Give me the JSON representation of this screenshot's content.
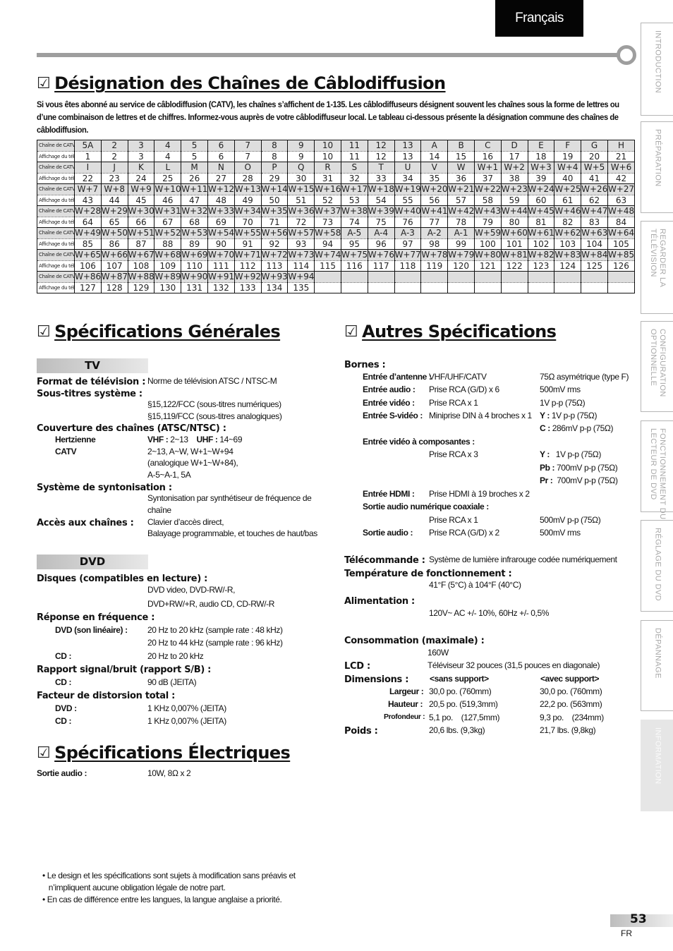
{
  "language_tab": "Français",
  "side_tabs": [
    {
      "label": "INTRODUCTION",
      "active": false
    },
    {
      "label": "PRÉPARATION",
      "active": false
    },
    {
      "label": "REGARDER LA\nTÉLÉVISION",
      "active": false
    },
    {
      "label": "CONFIGURATION\nOPTIONNELLE",
      "active": false
    },
    {
      "label": "FONCTIONNEMENT DU\nLECTEUR DE DVD",
      "active": false
    },
    {
      "label": "RÉGLAGE DU DVD",
      "active": false
    },
    {
      "label": "DÉPANNAGE",
      "active": false
    },
    {
      "label": "INFORMATION",
      "active": true
    }
  ],
  "checkbox_icon": "☑",
  "cable": {
    "title": "Désignation des Chaînes de Câblodiffusion",
    "intro": "Si vous êtes abonné au service de câblodiffusion (CATV), les chaînes s’affichent de 1-135. Les câblodiffuseurs désignent souvent les chaînes sous la forme de lettres ou d’une combinaison de lettres et de chiffres. Informez-vous auprès de votre câblodiffuseur local. Le tableau ci-dessous présente la désignation commune des chaînes de câblodiffusion.",
    "row_label_catv": "Chaîne de CATV",
    "row_label_display": "Affichage du téléviseur",
    "rows": [
      {
        "catv": [
          "5A",
          "2",
          "3",
          "4",
          "5",
          "6",
          "7",
          "8",
          "9",
          "10",
          "11",
          "12",
          "13",
          "A",
          "B",
          "C",
          "D",
          "E",
          "F",
          "G",
          "H"
        ],
        "display": [
          "1",
          "2",
          "3",
          "4",
          "5",
          "6",
          "7",
          "8",
          "9",
          "10",
          "11",
          "12",
          "13",
          "14",
          "15",
          "16",
          "17",
          "18",
          "19",
          "20",
          "21"
        ]
      },
      {
        "catv": [
          "I",
          "J",
          "K",
          "L",
          "M",
          "N",
          "O",
          "P",
          "Q",
          "R",
          "S",
          "T",
          "U",
          "V",
          "W",
          "W+1",
          "W+2",
          "W+3",
          "W+4",
          "W+5",
          "W+6"
        ],
        "display": [
          "22",
          "23",
          "24",
          "25",
          "26",
          "27",
          "28",
          "29",
          "30",
          "31",
          "32",
          "33",
          "34",
          "35",
          "36",
          "37",
          "38",
          "39",
          "40",
          "41",
          "42"
        ]
      },
      {
        "catv": [
          "W+7",
          "W+8",
          "W+9",
          "W+10",
          "W+11",
          "W+12",
          "W+13",
          "W+14",
          "W+15",
          "W+16",
          "W+17",
          "W+18",
          "W+19",
          "W+20",
          "W+21",
          "W+22",
          "W+23",
          "W+24",
          "W+25",
          "W+26",
          "W+27"
        ],
        "display": [
          "43",
          "44",
          "45",
          "46",
          "47",
          "48",
          "49",
          "50",
          "51",
          "52",
          "53",
          "54",
          "55",
          "56",
          "57",
          "58",
          "59",
          "60",
          "61",
          "62",
          "63"
        ]
      },
      {
        "catv": [
          "W+28",
          "W+29",
          "W+30",
          "W+31",
          "W+32",
          "W+33",
          "W+34",
          "W+35",
          "W+36",
          "W+37",
          "W+38",
          "W+39",
          "W+40",
          "W+41",
          "W+42",
          "W+43",
          "W+44",
          "W+45",
          "W+46",
          "W+47",
          "W+48"
        ],
        "display": [
          "64",
          "65",
          "66",
          "67",
          "68",
          "69",
          "70",
          "71",
          "72",
          "73",
          "74",
          "75",
          "76",
          "77",
          "78",
          "79",
          "80",
          "81",
          "82",
          "83",
          "84"
        ]
      },
      {
        "catv": [
          "W+49",
          "W+50",
          "W+51",
          "W+52",
          "W+53",
          "W+54",
          "W+55",
          "W+56",
          "W+57",
          "W+58",
          "A-5",
          "A-4",
          "A-3",
          "A-2",
          "A-1",
          "W+59",
          "W+60",
          "W+61",
          "W+62",
          "W+63",
          "W+64"
        ],
        "display": [
          "85",
          "86",
          "87",
          "88",
          "89",
          "90",
          "91",
          "92",
          "93",
          "94",
          "95",
          "96",
          "97",
          "98",
          "99",
          "100",
          "101",
          "102",
          "103",
          "104",
          "105"
        ]
      },
      {
        "catv": [
          "W+65",
          "W+66",
          "W+67",
          "W+68",
          "W+69",
          "W+70",
          "W+71",
          "W+72",
          "W+73",
          "W+74",
          "W+75",
          "W+76",
          "W+77",
          "W+78",
          "W+79",
          "W+80",
          "W+81",
          "W+82",
          "W+83",
          "W+84",
          "W+85"
        ],
        "display": [
          "106",
          "107",
          "108",
          "109",
          "110",
          "111",
          "112",
          "113",
          "114",
          "115",
          "116",
          "117",
          "118",
          "119",
          "120",
          "121",
          "122",
          "123",
          "124",
          "125",
          "126"
        ]
      },
      {
        "catv": [
          "W+86",
          "W+87",
          "W+88",
          "W+89",
          "W+90",
          "W+91",
          "W+92",
          "W+93",
          "W+94",
          "",
          "",
          "",
          "",
          "",
          "",
          "",
          "",
          "",
          "",
          "",
          ""
        ],
        "display": [
          "127",
          "128",
          "129",
          "130",
          "131",
          "132",
          "133",
          "134",
          "135",
          "",
          "",
          "",
          "",
          "",
          "",
          "",
          "",
          "",
          "",
          "",
          ""
        ]
      }
    ]
  },
  "general": {
    "title": "Spécifications Générales",
    "tv_bar": "TV",
    "format_label": "Format de télévision :",
    "format_value": "Norme de télévision ATSC / NTSC-M",
    "subtitles_label": "Sous-titres système :",
    "subtitles_1": "§15,122/FCC (sous-titres numériques)",
    "subtitles_2": "§15,119/FCC (sous-titres analogiques)",
    "coverage_label": "Couverture des chaînes (ATSC/NTSC) :",
    "hertz_label": "Hertzienne",
    "vhf_label": "VHF :",
    "vhf_value": "2~13",
    "uhf_label": "UHF :",
    "uhf_value": "14~69",
    "catv_label": "CATV",
    "catv_1": "2~13, A~W, W+1~W+94",
    "catv_2": "(analogique W+1~W+84),",
    "catv_3": "A-5~A-1, 5A",
    "tuning_label": "Système de syntonisation :",
    "tuning_1": "Syntonisation par synthétiseur de fréquence de",
    "tuning_2": "chaîne",
    "access_label": "Accès aux chaînes :",
    "access_1": "Clavier d’accès direct,",
    "access_2": "Balayage programmable, et touches de haut/bas",
    "dvd_bar": "DVD",
    "discs_label": "Disques (compatibles en lecture) :",
    "discs_1": "DVD video, DVD-RW/-R,",
    "discs_2": "DVD+RW/+R, audio CD, CD-RW/-R",
    "freq_label": "Réponse en fréquence :",
    "freq_dvd_label": "DVD (son linéaire) :",
    "freq_dvd_1": "20 Hz to 20 kHz (sample rate : 48 kHz)",
    "freq_dvd_2": "20 Hz to 44 kHz (sample rate : 96 kHz)",
    "freq_cd_label": "CD :",
    "freq_cd": "20 Hz to 20 kHz",
    "snr_label": "Rapport signal/bruit (rapport S/B) :",
    "snr_cd_label": "CD :",
    "snr_cd": "90 dB (JEITA)",
    "thd_label": "Facteur de distorsion total :",
    "thd_dvd_label": "DVD :",
    "thd_dvd": "1 KHz  0,007% (JEITA)",
    "thd_cd_label": "CD :",
    "thd_cd": "1 KHz  0,007% (JEITA)"
  },
  "electrical": {
    "title": "Spécifications Électriques",
    "audio_label": "Sortie audio :",
    "audio_value": "10W, 8Ω x 2"
  },
  "other": {
    "title": "Autres Spécifications",
    "terminals_label": "Bornes :",
    "antenna_label": "Entrée d’antenne :",
    "antenna_value": "VHF/UHF/CATV",
    "antenna_spec": "75Ω asymétrique (type F)",
    "audio_in_label": "Entrée audio :",
    "audio_in_value": "Prise RCA (G/D) x 6",
    "audio_in_spec": "500mV rms",
    "video_in_label": "Entrée vidéo :",
    "video_in_value": "Prise RCA x 1",
    "video_in_spec": "1V p-p (75Ω)",
    "svideo_label": "Entrée S-vidéo :",
    "svideo_value": "Miniprise DIN à 4 broches x 1",
    "svideo_y_label": "Y :",
    "svideo_y": "1V p-p (75Ω)",
    "svideo_c_label": "C :",
    "svideo_c": "286mV p-p (75Ω)",
    "component_label": "Entrée vidéo à composantes :",
    "component_value": "Prise RCA x 3",
    "comp_y_label": "Y :",
    "comp_y": "1V p-p (75Ω)",
    "comp_pb_label": "Pb :",
    "comp_pb": "700mV p-p (75Ω)",
    "comp_pr_label": "Pr :",
    "comp_pr": "700mV p-p (75Ω)",
    "hdmi_label": "Entrée HDMI :",
    "hdmi_value": "Prise HDMI à 19 broches x 2",
    "coax_label": "Sortie audio numérique coaxiale :",
    "coax_value": "Prise RCA x 1",
    "coax_spec": "500mV p-p (75Ω)",
    "audio_out_label": "Sortie audio :",
    "audio_out_value": "Prise RCA (G/D) x 2",
    "audio_out_spec": "500mV rms",
    "remote_label": "Télécommande :",
    "remote_value": "Système de lumière infrarouge codée numériquement",
    "temp_label": "Température de fonctionnement :",
    "temp_value": "41°F (5°C) à 104°F (40°C)",
    "power_label": "Alimentation :",
    "power_value": "120V~ AC +/- 10%, 60Hz +/- 0,5%",
    "consumption_label": "Consommation (maximale) :",
    "consumption_value": "160W",
    "lcd_label": "LCD :",
    "lcd_value": "Téléviseur 32 pouces (31,5 pouces en diagonale)",
    "dims_label": "Dimensions :",
    "dims_without": "<sans support>",
    "dims_with": "<avec support>",
    "width_label": "Largeur :",
    "width_without": "30,0 po.  (760mm)",
    "width_with": "30,0 po.  (760mm)",
    "height_label": "Hauteur :",
    "height_without": "20,5 po.  (519,3mm)",
    "height_with": "22,2 po.  (563mm)",
    "depth_label": "Profondeur :",
    "depth_without": "5,1 po.    (127,5mm)",
    "depth_with": "9,3 po.    (234mm)",
    "weight_label": "Poids :",
    "weight_without": "20,6 lbs. (9,3kg)",
    "weight_with": "21,7 lbs. (9,8kg)"
  },
  "footnotes": [
    "• Le design et les spécifications sont sujets à modification sans préavis et",
    "   n’impliquent aucune obligation légale de notre part.",
    "• En cas de différence entre les langues, la langue anglaise a priorité."
  ],
  "page_number": "53",
  "page_lang": "FR"
}
